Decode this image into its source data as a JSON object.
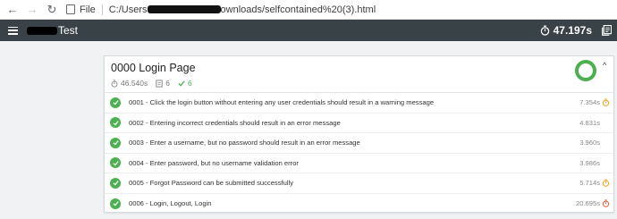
{
  "browser": {
    "file_label": "File",
    "url_prefix": "C:/Users",
    "url_suffix": "ownloads/selfcontained%20(3).html"
  },
  "app": {
    "title_suffix": "Test",
    "total_time": "47.197s"
  },
  "suite": {
    "title": "0000 Login Page",
    "duration": "46.540s",
    "count": "6",
    "passed": "6",
    "pass_ratio": 1.0,
    "colors": {
      "pass": "#4caf50",
      "warn_clock": "#f5a623",
      "slow_clock": "#e8613a"
    },
    "tests": [
      {
        "name": "0001 - Click the login button without entering any user credentials should result in a warning message",
        "duration": "7.354s",
        "clock": "warn"
      },
      {
        "name": "0002 - Entering incorrect credentials should result in an error message",
        "duration": "4.831s",
        "clock": "none"
      },
      {
        "name": "0003 - Enter a username, but no password should result in an error message",
        "duration": "3.960s",
        "clock": "none"
      },
      {
        "name": "0004 - Enter password, but no username validation error",
        "duration": "3.986s",
        "clock": "none"
      },
      {
        "name": "0005 - Forgot Password can be submitted successfully",
        "duration": "5.714s",
        "clock": "warn"
      },
      {
        "name": "0006 - Login, Logout, Login",
        "duration": "20.695s",
        "clock": "slow"
      }
    ]
  }
}
